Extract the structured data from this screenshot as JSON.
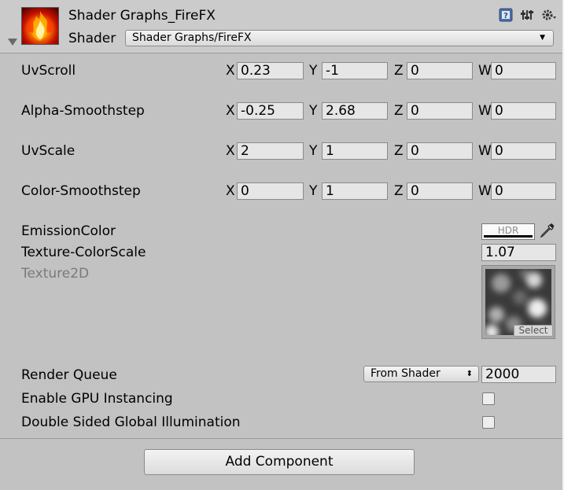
{
  "header": {
    "material_name": "Shader Graphs_FireFX",
    "shader_label": "Shader",
    "shader_value": "Shader Graphs/FireFX",
    "icons": [
      "help-icon",
      "preset-icon",
      "gear-icon"
    ]
  },
  "vectors": [
    {
      "label": "UvScroll",
      "x": "0.23",
      "y": "-1",
      "z": "0",
      "w": "0"
    },
    {
      "label": "Alpha-Smoothstep",
      "x": "-0.25",
      "y": "2.68",
      "z": "0",
      "w": "0"
    },
    {
      "label": "UvScale",
      "x": "2",
      "y": "1",
      "z": "0",
      "w": "0"
    },
    {
      "label": "Color-Smoothstep",
      "x": "0",
      "y": "1",
      "z": "0",
      "w": "0"
    }
  ],
  "axes": {
    "x": "X",
    "y": "Y",
    "z": "Z",
    "w": "W"
  },
  "emission": {
    "label": "EmissionColor",
    "hdr_text": "HDR",
    "icon": "eyedropper-icon"
  },
  "texture_colorscale": {
    "label": "Texture-ColorScale",
    "value": "1.07"
  },
  "texture2d": {
    "label": "Texture2D",
    "select_label": "Select"
  },
  "render_queue": {
    "label": "Render Queue",
    "mode": "From Shader",
    "value": "2000"
  },
  "gpu_instancing": {
    "label": "Enable GPU Instancing",
    "checked": false
  },
  "double_sided_gi": {
    "label": "Double Sided Global Illumination",
    "checked": false
  },
  "add_component": {
    "label": "Add Component"
  }
}
